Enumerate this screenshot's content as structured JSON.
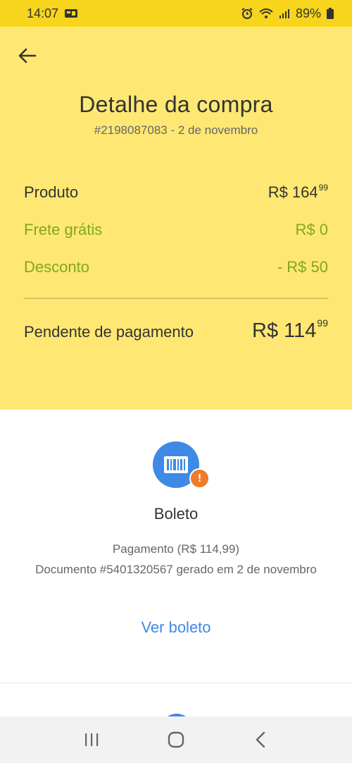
{
  "status_bar": {
    "time": "14:07",
    "battery": "89%",
    "icons": [
      "message-icon",
      "alarm-icon",
      "wifi-icon",
      "signal-icon",
      "battery-icon"
    ]
  },
  "header": {
    "title": "Detalhe da compra",
    "subtitle": "#2198087083 - 2 de novembro",
    "background_color": "#fee873"
  },
  "summary": {
    "product_label": "Produto",
    "product_value": "R$ 164",
    "product_cents": "99",
    "shipping_label": "Frete grátis",
    "shipping_value": "R$ 0",
    "discount_label": "Desconto",
    "discount_value": "- R$ 50",
    "total_label": "Pendente de pagamento",
    "total_value": "R$ 114",
    "total_cents": "99",
    "accent_green": "#83a81b"
  },
  "payment": {
    "method": "Boleto",
    "amount_line": "Pagamento (R$ 114,99)",
    "document_line": "Documento #5401320567 gerado em 2 de novembro",
    "link_label": "Ver boleto",
    "icon": "barcode-icon",
    "badge_icon": "exclamation-icon",
    "icon_color": "#3e8ae6",
    "badge_color": "#ee7c29"
  },
  "nav_bar": {
    "buttons": [
      "recent-apps-icon",
      "home-icon",
      "back-icon"
    ]
  }
}
